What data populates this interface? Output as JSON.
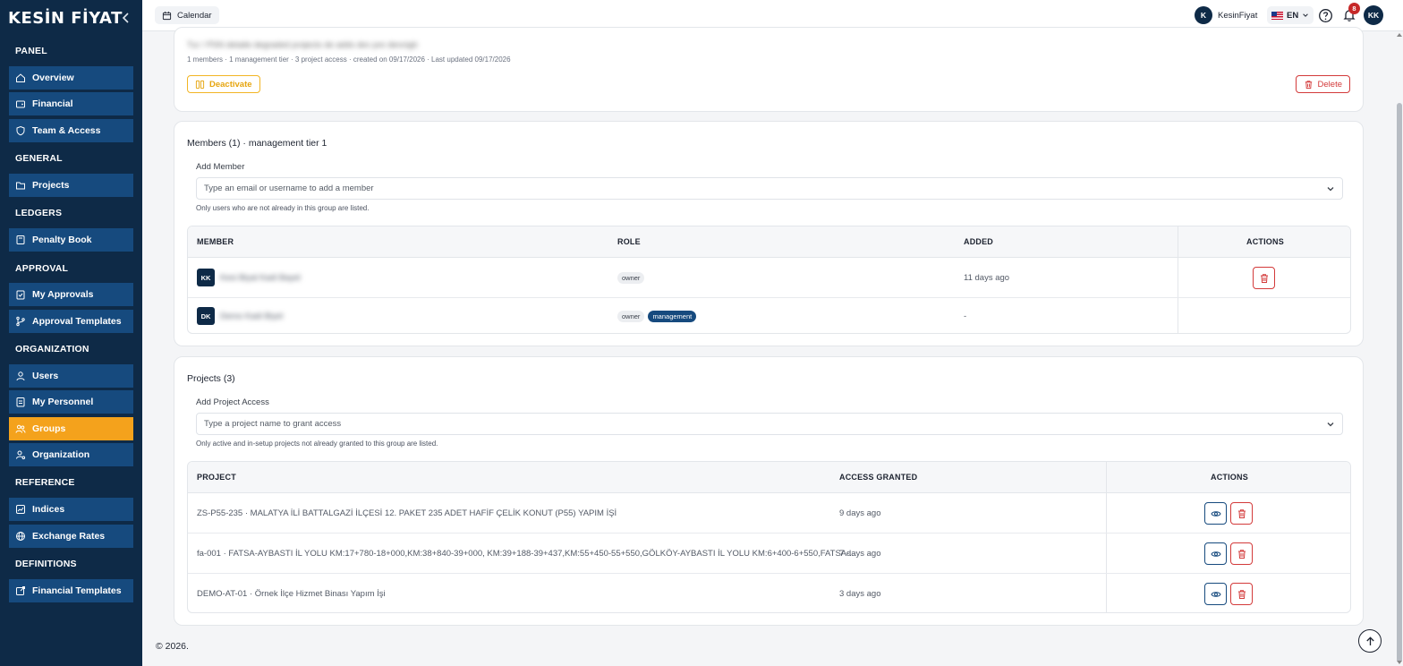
{
  "brand": {
    "logo": "KESİN FİYAT"
  },
  "sidebar": {
    "sections": [
      {
        "title": "PANEL",
        "items": [
          {
            "label": "Overview",
            "icon": "home-icon"
          },
          {
            "label": "Financial",
            "icon": "wallet-icon"
          },
          {
            "label": "Team & Access",
            "icon": "shield-icon"
          }
        ]
      },
      {
        "title": "GENERAL",
        "items": [
          {
            "label": "Projects",
            "icon": "folder-icon"
          }
        ]
      },
      {
        "title": "LEDGERS",
        "items": [
          {
            "label": "Penalty Book",
            "icon": "book-icon"
          }
        ]
      },
      {
        "title": "APPROVAL",
        "items": [
          {
            "label": "My Approvals",
            "icon": "clipboard-check-icon"
          },
          {
            "label": "Approval Templates",
            "icon": "git-branch-icon"
          }
        ]
      },
      {
        "title": "ORGANIZATION",
        "items": [
          {
            "label": "Users",
            "icon": "user-icon"
          },
          {
            "label": "My Personnel",
            "icon": "id-card-icon"
          },
          {
            "label": "Groups",
            "icon": "users-icon",
            "active": true
          },
          {
            "label": "Organization",
            "icon": "user-cog-icon"
          }
        ]
      },
      {
        "title": "REFERENCE",
        "items": [
          {
            "label": "Indices",
            "icon": "chart-icon"
          },
          {
            "label": "Exchange Rates",
            "icon": "globe-icon"
          }
        ]
      },
      {
        "title": "DEFINITIONS",
        "items": [
          {
            "label": "Financial Templates",
            "icon": "external-doc-icon"
          }
        ]
      }
    ]
  },
  "header": {
    "calendar_label": "Calendar",
    "user_initial": "K",
    "user_name": "KesinFiyat",
    "language": "EN",
    "notification_count": "8",
    "avatar_initials": "KK"
  },
  "group": {
    "description_blurred": "Tur / PSN detaile degraded projects de adds dev pre dennigh",
    "meta": "1 members · 1 management tier · 3 project access · created on 09/17/2026 · Last updated 09/17/2026",
    "deactivate_label": "Deactivate",
    "delete_label": "Delete"
  },
  "members": {
    "title": "Members (1) · management tier 1",
    "add_label": "Add Member",
    "add_placeholder": "Type an email or username to add a member",
    "hint": "Only users who are not already in this group are listed.",
    "columns": {
      "member": "MEMBER",
      "role": "ROLE",
      "added": "ADDED",
      "actions": "ACTIONS"
    },
    "rows": [
      {
        "initials": "KK",
        "name_blurred": "Kesi Biyal Kadi Bayel",
        "roles": [
          "owner"
        ],
        "added": "11 days ago"
      },
      {
        "initials": "DK",
        "name_blurred": "Demo Kadi Biyel",
        "roles": [
          "owner",
          "management"
        ],
        "added": "-"
      }
    ]
  },
  "projects": {
    "title": "Projects (3)",
    "add_label": "Add Project Access",
    "add_placeholder": "Type a project name to grant access",
    "hint": "Only active and in-setup projects not already granted to this group are listed.",
    "columns": {
      "project": "PROJECT",
      "access": "ACCESS GRANTED",
      "actions": "ACTIONS"
    },
    "rows": [
      {
        "name": "ZS-P55-235 · MALATYA İLİ BATTALGAZİ İLÇESİ 12. PAKET 235 ADET HAFİF ÇELİK KONUT (P55) YAPIM İŞİ",
        "access": "9 days ago"
      },
      {
        "name": "fa-001 · FATSA-AYBASTI İL YOLU KM:17+780-18+000,KM:38+840-39+000, KM:39+188-39+437,KM:55+450-55+550,GÖLKÖY-AYBASTI İL YOLU KM:6+400-6+550,FATSA-...",
        "access": "7 days ago"
      },
      {
        "name": "DEMO-AT-01 · Örnek İlçe Hizmet Binası Yapım İşi",
        "access": "3 days ago"
      }
    ]
  },
  "footer": {
    "copyright": "© 2026."
  }
}
